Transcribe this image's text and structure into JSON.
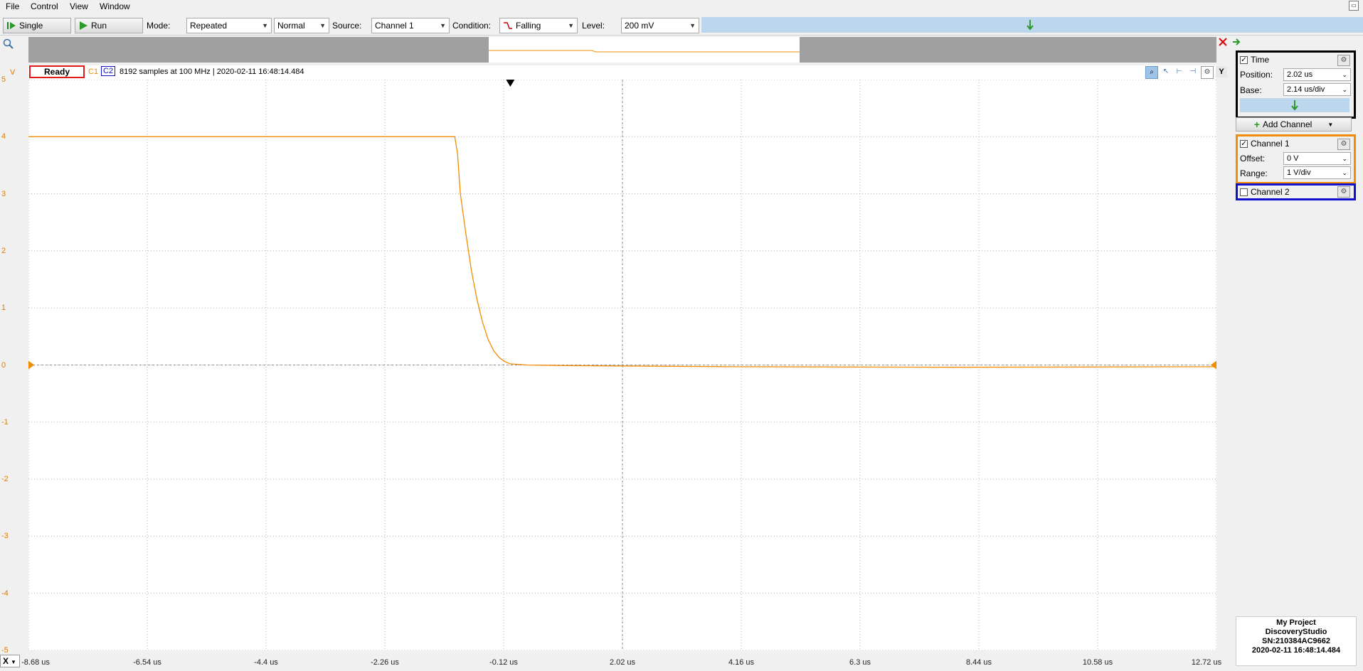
{
  "menu": [
    "File",
    "Control",
    "View",
    "Window"
  ],
  "toolbar": {
    "single_label": "Single",
    "run_label": "Run",
    "mode_label": "Mode:",
    "mode_value": "Repeated",
    "mode2_value": "Normal",
    "source_label": "Source:",
    "source_value": "Channel 1",
    "condition_label": "Condition:",
    "condition_value": "Falling",
    "level_label": "Level:",
    "level_value": "200 mV"
  },
  "infobar": {
    "status": "Ready",
    "c1": "C1",
    "c2": "C2",
    "info_text": "8192 samples at 100 MHz | 2020-02-11 16:48:14.484",
    "y_button": "Y"
  },
  "y_axis": {
    "unit": "V",
    "ticks": [
      "5",
      "4",
      "3",
      "2",
      "1",
      "0",
      "-1",
      "-2",
      "-3",
      "-4",
      "-5"
    ]
  },
  "x_axis": {
    "ticks": [
      "-8.68 us",
      "-6.54 us",
      "-4.4 us",
      "-2.26 us",
      "-0.12 us",
      "2.02 us",
      "4.16 us",
      "6.3 us",
      "8.44 us",
      "10.58 us",
      "12.72 us"
    ],
    "x_button": "X"
  },
  "chart_data": {
    "type": "line",
    "xlabel": "",
    "ylabel": "V",
    "xlim": [
      -8.68,
      12.72
    ],
    "ylim": [
      -5,
      5
    ],
    "grid": true,
    "series": [
      {
        "name": "C1",
        "x": [
          -8.68,
          -1.0,
          -0.95,
          -0.9,
          -0.8,
          -0.7,
          -0.6,
          -0.5,
          -0.4,
          -0.3,
          -0.2,
          -0.1,
          0.0,
          0.3,
          1.0,
          4.0,
          8.0,
          12.72
        ],
        "y": [
          4.0,
          4.0,
          3.7,
          3.0,
          2.3,
          1.65,
          1.15,
          0.75,
          0.45,
          0.25,
          0.13,
          0.06,
          0.02,
          0.0,
          -0.01,
          -0.03,
          -0.04,
          -0.03
        ]
      }
    ],
    "colors": {
      "c1": "#f28c00",
      "c2": "#1010c8",
      "grid": "#b0b0b0"
    }
  },
  "panel": {
    "time_label": "Time",
    "position_label": "Position:",
    "position_value": "2.02 us",
    "base_label": "Base:",
    "base_value": "2.14 us/div",
    "add_channel_label": "Add Channel",
    "ch1_label": "Channel 1",
    "offset_label": "Offset:",
    "offset_value": "0 V",
    "range_label": "Range:",
    "range_value": "1 V/div",
    "ch2_label": "Channel 2"
  },
  "project": {
    "name": "My Project",
    "device": "DiscoveryStudio",
    "serial": "SN:210384AC9662",
    "timestamp": "2020-02-11 16:48:14.484"
  }
}
